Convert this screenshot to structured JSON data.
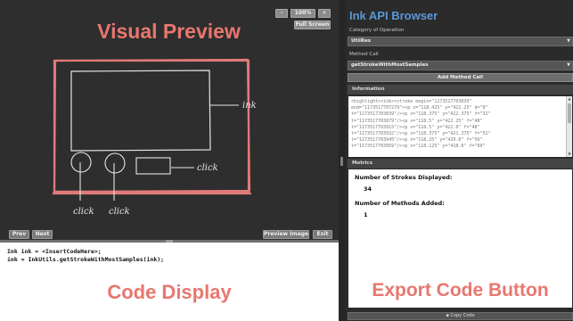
{
  "preview": {
    "title": "Visual Preview",
    "zoom_out": "-",
    "zoom_level": "100%",
    "zoom_in": "+",
    "fullscreen_label": "Full Screen",
    "prev_label": "Prev",
    "next_label": "Next",
    "preview_image_label": "Preview Image",
    "exit_label": "Exit",
    "sketch": {
      "ink_label": "ink",
      "click_labels": [
        "click",
        "click",
        "click"
      ]
    }
  },
  "code": {
    "lines": [
      "Ink ink = <InsertCodeHere>;",
      "ink = InkUtils.getStrokeWithMostSamples(ink);"
    ],
    "title": "Code Display"
  },
  "browser": {
    "title": "Ink API Browser",
    "category_label": "Category of Operation",
    "category_value": "UtilRes",
    "method_label": "Method Call",
    "method_value": "getStrokeWithMostSamples",
    "add_method_label": "Add Method Call",
    "info_label": "Information",
    "info_lines": [
      "<highlight><ink><stroke begin=\"1173517703839\"",
      "end=\"1173517707279\"><p x=\"118.425\" y=\"422.25\" d=\"0\"",
      "t=\"1173517703839\"/><p x=\"118.375\" y=\"422.375\" f=\"32\"",
      "t=\"1173517703879\"/><p x=\"118.5\" y=\"422.25\" f=\"48\"",
      "t=\"1173517703915\"/><p x=\"118.5\" y=\"422.0\" f=\"48\"",
      "t=\"1173517703932\"/><p x=\"118.375\" y=\"421.375\" f=\"52\"",
      "t=\"1173517703945\"/><p x=\"118.25\" y=\"420.0\" f=\"56\"",
      "t=\"1173517703959\"/><p x=\"118.125\" y=\"418.0\" f=\"60\""
    ],
    "metrics_label": "Metrics",
    "strokes_label": "Number of Strokes Displayed:",
    "strokes_value": "34",
    "methods_label": "Number of Methods Added:",
    "methods_value": "1",
    "export_title": "Export Code Button",
    "copy_label": "Copy Code"
  },
  "colors": {
    "accent_title": "#e8776f",
    "browser_title": "#5a98d8",
    "sketch_frame": "#e07a78"
  }
}
